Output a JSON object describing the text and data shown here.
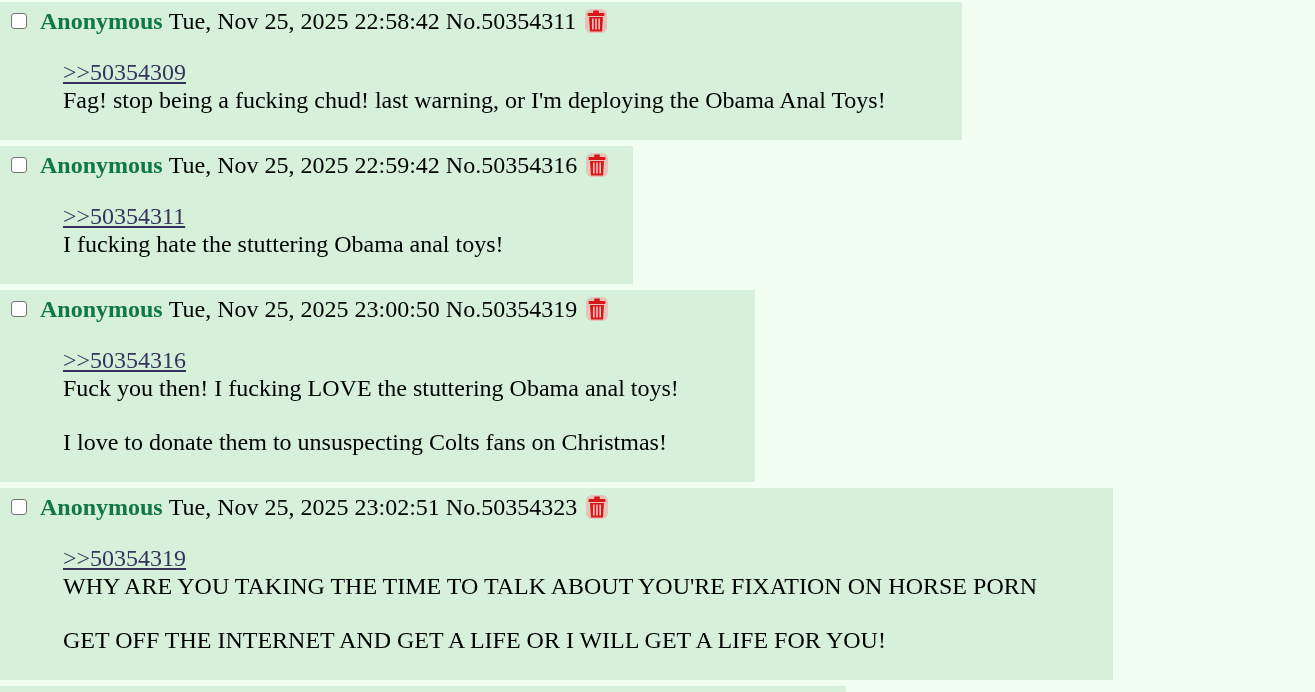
{
  "posts": [
    {
      "kind": "reply",
      "checked": false,
      "name": "Anonymous",
      "datetime": "Tue, Nov 25, 2025 22:58:42",
      "post_number": "No.50354311",
      "quote_link": ">>50354309",
      "paragraphs": [
        "Fag! stop being a fucking chud! last warning, or I'm deploying the Obama Anal Toys!"
      ]
    },
    {
      "kind": "reply",
      "checked": false,
      "name": "Anonymous",
      "datetime": "Tue, Nov 25, 2025 22:59:42",
      "post_number": "No.50354316",
      "quote_link": ">>50354311",
      "paragraphs": [
        "I fucking hate the stuttering Obama anal toys!"
      ]
    },
    {
      "kind": "reply",
      "checked": false,
      "name": "Anonymous",
      "datetime": "Tue, Nov 25, 2025 23:00:50",
      "post_number": "No.50354319",
      "quote_link": ">>50354316",
      "paragraphs": [
        "Fuck you then! I fucking LOVE the stuttering Obama anal toys!",
        "I love to donate them to unsuspecting Colts fans on Christmas!"
      ]
    },
    {
      "kind": "reply",
      "checked": false,
      "name": "Anonymous",
      "datetime": "Tue, Nov 25, 2025 23:02:51",
      "post_number": "No.50354323",
      "quote_link": ">>50354319",
      "paragraphs": [
        "WHY ARE YOU TAKING THE TIME TO TALK ABOUT YOU'RE FIXATION ON HORSE PORN",
        "GET OFF THE INTERNET AND GET A LIFE OR I WILL GET A LIFE FOR YOU!"
      ]
    },
    {
      "kind": "partial"
    }
  ]
}
